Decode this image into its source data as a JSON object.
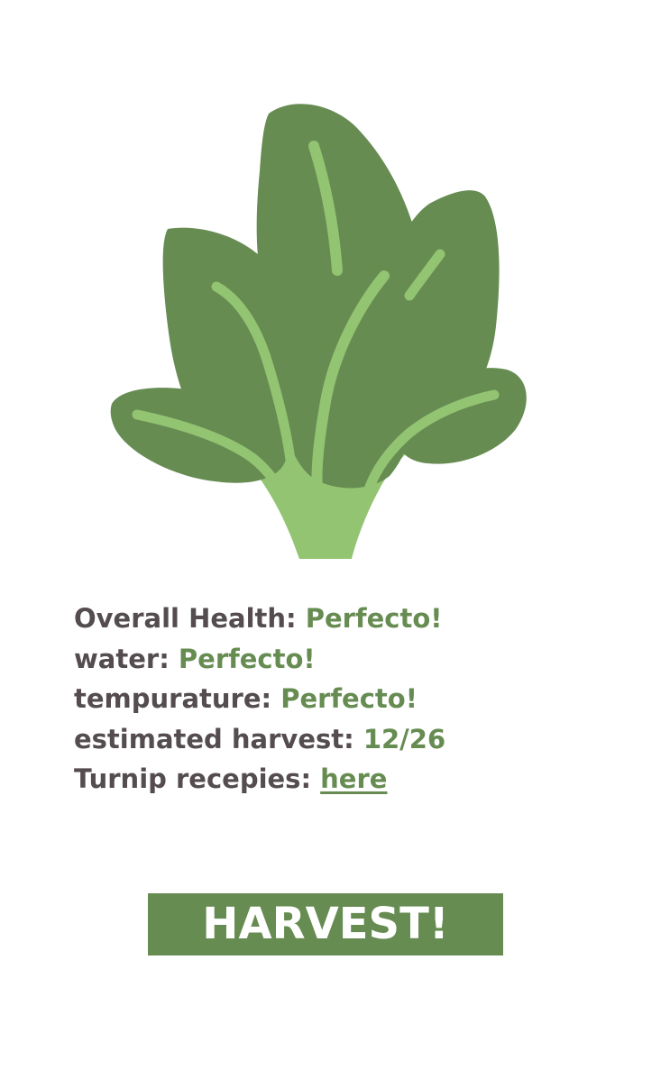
{
  "plant": {
    "icon": "spinach-plant-icon",
    "colors": {
      "leaf": "#668c52",
      "vein": "#93c472"
    }
  },
  "stats": [
    {
      "label": "Overall Health:",
      "value": "Perfecto!"
    },
    {
      "label": "water:",
      "value": "Perfecto!"
    },
    {
      "label": "tempurature:",
      "value": "Perfecto!"
    },
    {
      "label": "estimated harvest:",
      "value": "12/26"
    }
  ],
  "recipes": {
    "label": "Turnip recepies:",
    "link_text": "here"
  },
  "harvest_button": {
    "label": "HARVEST!"
  },
  "colors": {
    "label_text": "#544c4f",
    "accent": "#668c52",
    "button_text": "#ffffff"
  }
}
